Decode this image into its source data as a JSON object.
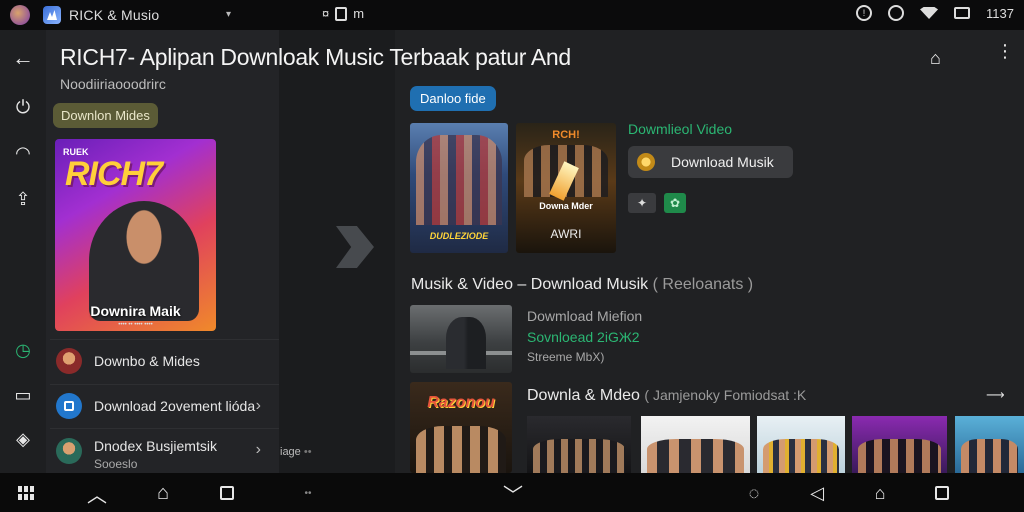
{
  "status_bar": {
    "app_title": "RICK & Musio",
    "menu_glyph": "▾",
    "center_text": "¤",
    "center_text2": "m",
    "right_text": "1137",
    "alert_glyph": "!"
  },
  "header": {
    "back_glyph": "←",
    "title": "RICH7- Aplipan Downloak Music Terbaak patur And",
    "subtitle": "Noodiiriaooodrirc",
    "home_glyph": "⌂",
    "more_glyph": "⋮"
  },
  "left_panel": {
    "chip_label": "Downlon Mides",
    "hero": {
      "small_text": "RUEK",
      "big_text": "RICH7",
      "label": "Downira Maik",
      "tiny_text": "•••• •• •••• ••••"
    },
    "rows": [
      {
        "label": "Downbo & Mides",
        "sub": ""
      },
      {
        "label": "Download 2ovement lióda",
        "sub": ""
      },
      {
        "label": "Dnodex Busjiemtsik",
        "sub": "Sooeslo"
      }
    ],
    "chevron_glyph": "›"
  },
  "rail": {
    "icons": [
      "power-icon",
      "headphones-icon",
      "upload-icon",
      "clock-icon",
      "cast-icon",
      "tag-icon"
    ],
    "glyphs": [
      "⏻",
      "◠",
      "⇪",
      "◷",
      "▭",
      "◈"
    ]
  },
  "middle": {
    "label": "iage",
    "dots": "••"
  },
  "right_panel": {
    "chip_label": "Danloo fide",
    "poster1_title": "DUDLEZIODE",
    "poster2_top": "RCH!",
    "poster2_title": "Downa Mder",
    "poster2_sub": "AWRI",
    "green_label": "Dowmlieol Video",
    "download_button": "Download Musik",
    "mini_button1": "✦",
    "mini_button2": "✿",
    "section_title": "Musik & Video  –  Download Musik",
    "section_muted": "( Reeloanats )",
    "featured": {
      "title": "Dowmload Miefion",
      "green": "Sovnloead 2іGЖ2",
      "sub": "Streeme MbX)"
    },
    "big_thumb_title": "Razonou",
    "row2_title": "Downla & Mdeo",
    "row2_muted": "( Jamjenoky Fomiodsat :K",
    "row2_arrow": "⟶"
  },
  "bottom_nav": {
    "up_glyph": "︿",
    "home_glyph": "⌂",
    "down_glyph": "﹀",
    "search_glyph": "◌",
    "back_glyph": "◁",
    "dots": "••"
  },
  "colors": {
    "accent_green": "#2bb673",
    "accent_blue": "#1f6fb1",
    "chip_olive": "#5b5b36",
    "background": "#1b1c1e"
  }
}
